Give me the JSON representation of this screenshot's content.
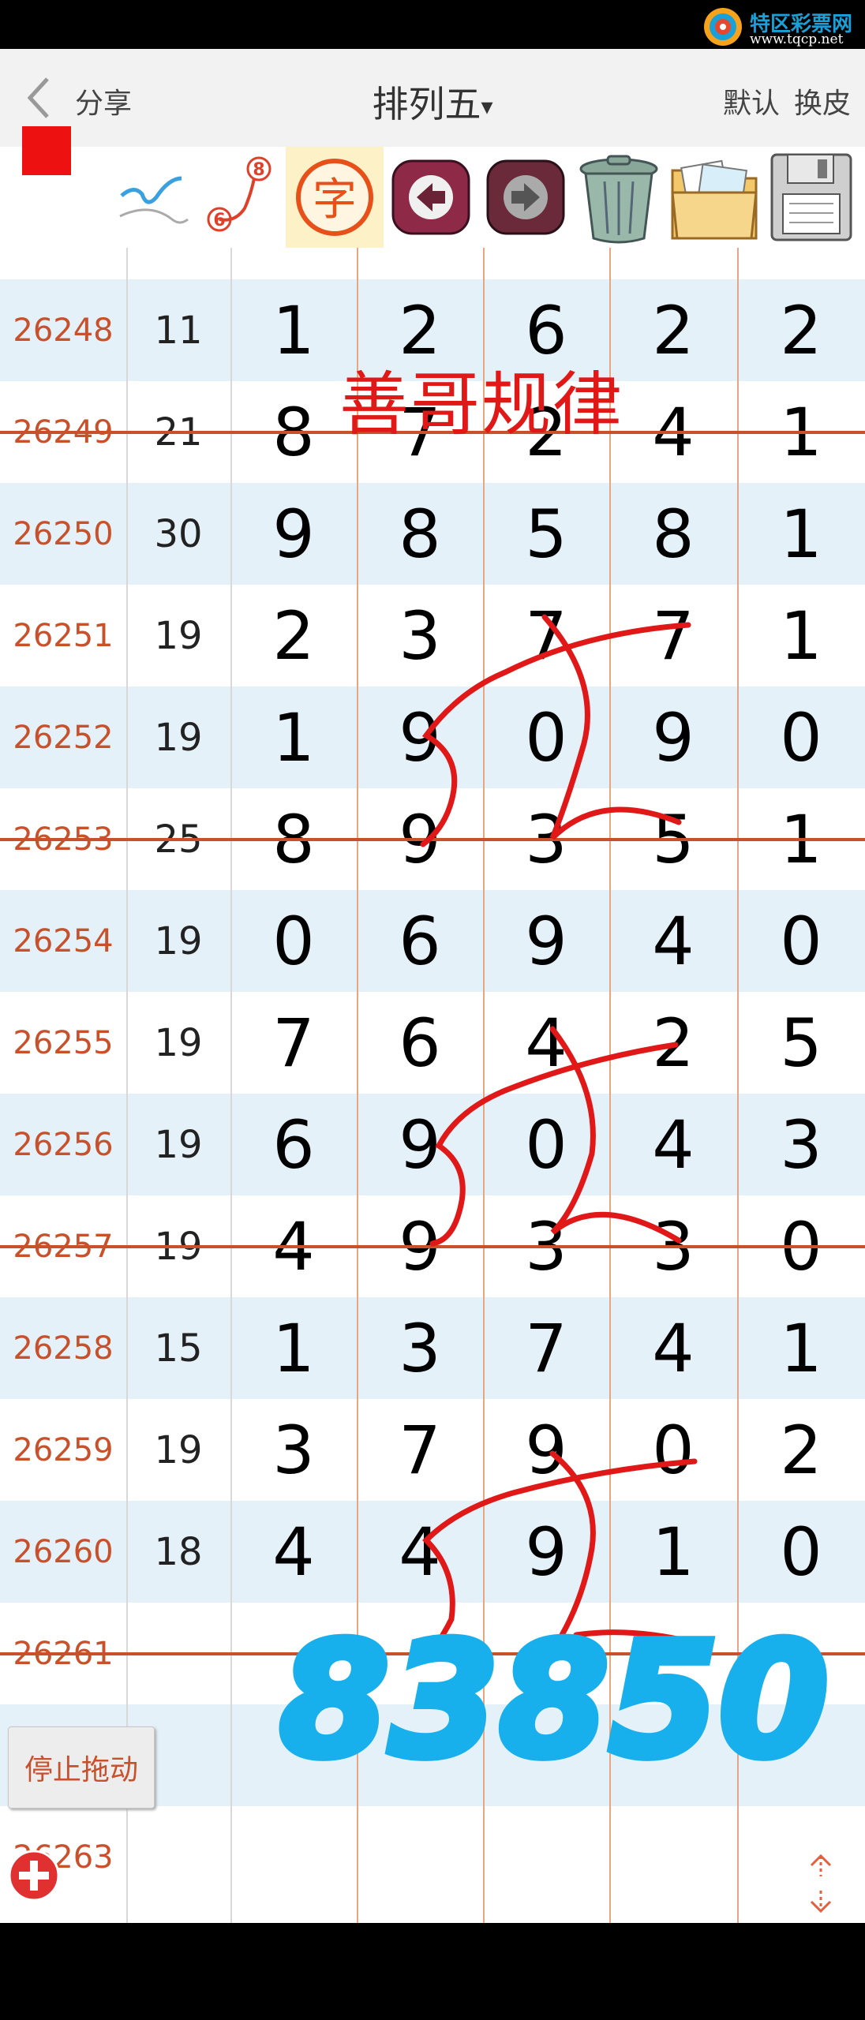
{
  "watermark": {
    "name": "特区彩票网",
    "url": "www.tqcp.net"
  },
  "header": {
    "share_label": "分享",
    "title": "排列五",
    "title_caret": "▾",
    "right_default": "默认",
    "right_skin": "换皮"
  },
  "toolbar": {
    "icons": [
      "red-square",
      "pen-check-icon",
      "link-6-8-icon",
      "zi-char-icon",
      "back-arrow-icon",
      "forward-arrow-icon",
      "trash-can-icon",
      "photo-folder-icon",
      "floppy-disk-icon"
    ],
    "badge_low": "6",
    "badge_high": "8",
    "zi_char": "字"
  },
  "rows": [
    {
      "issue": "26248",
      "sum": "11",
      "digits": [
        "1",
        "2",
        "6",
        "2",
        "2"
      ]
    },
    {
      "issue": "26249",
      "sum": "21",
      "digits": [
        "8",
        "7",
        "2",
        "4",
        "1"
      ]
    },
    {
      "issue": "26250",
      "sum": "30",
      "digits": [
        "9",
        "8",
        "5",
        "8",
        "1"
      ]
    },
    {
      "issue": "26251",
      "sum": "19",
      "digits": [
        "2",
        "3",
        "7",
        "7",
        "1"
      ]
    },
    {
      "issue": "26252",
      "sum": "19",
      "digits": [
        "1",
        "9",
        "0",
        "9",
        "0"
      ]
    },
    {
      "issue": "26253",
      "sum": "25",
      "digits": [
        "8",
        "9",
        "3",
        "5",
        "1"
      ]
    },
    {
      "issue": "26254",
      "sum": "19",
      "digits": [
        "0",
        "6",
        "9",
        "4",
        "0"
      ]
    },
    {
      "issue": "26255",
      "sum": "19",
      "digits": [
        "7",
        "6",
        "4",
        "2",
        "5"
      ]
    },
    {
      "issue": "26256",
      "sum": "19",
      "digits": [
        "6",
        "9",
        "0",
        "4",
        "3"
      ]
    },
    {
      "issue": "26257",
      "sum": "19",
      "digits": [
        "4",
        "9",
        "3",
        "3",
        "0"
      ]
    },
    {
      "issue": "26258",
      "sum": "15",
      "digits": [
        "1",
        "3",
        "7",
        "4",
        "1"
      ]
    },
    {
      "issue": "26259",
      "sum": "19",
      "digits": [
        "3",
        "7",
        "9",
        "0",
        "2"
      ]
    },
    {
      "issue": "26260",
      "sum": "18",
      "digits": [
        "4",
        "4",
        "9",
        "1",
        "0"
      ]
    },
    {
      "issue": "26261",
      "sum": "",
      "digits": [
        "",
        "",
        "",
        "",
        ""
      ]
    },
    {
      "issue": "",
      "sum": "",
      "digits": [
        "",
        "",
        "",
        "",
        ""
      ]
    },
    {
      "issue": "26263",
      "sum": "",
      "digits": [
        "",
        "",
        "",
        "",
        ""
      ]
    }
  ],
  "overlay": {
    "rule_text": "善哥规律",
    "prediction_text": "83850",
    "colors": {
      "red_ink": "#e01818",
      "blue_ink": "#18b0ec",
      "issue_orange": "#c8502a",
      "row_blue": "#e4f1f9"
    }
  },
  "stop_drag_label": "停止拖动"
}
